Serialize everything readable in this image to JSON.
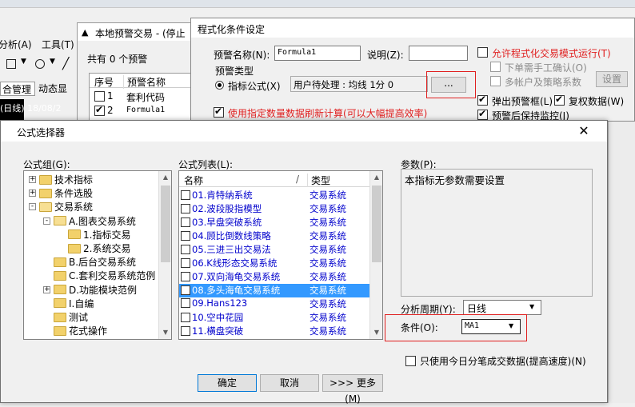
{
  "bg": {
    "menu_analysis": "分析(A)",
    "menu_tools": "工具(T)",
    "tab_manage": "合管理",
    "tab_dynamic": "动态显",
    "chart_label": "(日线) 18/08/2"
  },
  "local": {
    "title": "本地预警交易 - (停止",
    "count_text": "共有 0 个预警",
    "col_seq": "序号",
    "col_name": "预警名称",
    "rows": [
      {
        "seq": "1",
        "name": "套利代码",
        "checked": false
      },
      {
        "seq": "2",
        "name": "Formula1",
        "checked": true
      }
    ]
  },
  "condset": {
    "title": "程式化条件设定",
    "name_label": "预警名称(N):",
    "name_value": "Formula1",
    "desc_label": "说明(Z):",
    "desc_value": "",
    "allow_trade": "允许程式化交易模式运行(T)",
    "manual_confirm": "下单需手工确认(O)",
    "multi_account": "多帐户及策略系数",
    "setup_btn": "设置",
    "type_group": "预警类型",
    "type_formula": "指标公式(X)",
    "formula_display": "用户待处理 : 均线 1分  0",
    "browse_btn": "...",
    "popup_box": "弹出预警框(L)",
    "recheck": "复权数据(W)",
    "keep_monitor": "预警后保持监控(J)",
    "specified_refresh": "使用指定数量数据刷新计算(可以大幅提高效率)"
  },
  "selector": {
    "title": "公式选择器",
    "group_label": "公式组(G):",
    "list_label": "公式列表(L):",
    "col_name": "名称",
    "col_type": "类型",
    "sort_mark": "/",
    "tree": [
      {
        "level": 0,
        "expander": "+",
        "label": "技术指标"
      },
      {
        "level": 0,
        "expander": "+",
        "label": "条件选股"
      },
      {
        "level": 0,
        "expander": "-",
        "label": "交易系统"
      },
      {
        "level": 1,
        "expander": "-",
        "label": "A.图表交易系统"
      },
      {
        "level": 2,
        "expander": "",
        "label": "1.指标交易"
      },
      {
        "level": 2,
        "expander": "",
        "label": "2.系统交易"
      },
      {
        "level": 1,
        "expander": "",
        "label": "B.后台交易系统"
      },
      {
        "level": 1,
        "expander": "",
        "label": "C.套利交易系统范例"
      },
      {
        "level": 1,
        "expander": "+",
        "label": "D.功能模块范例"
      },
      {
        "level": 1,
        "expander": "",
        "label": "I.自编"
      },
      {
        "level": 1,
        "expander": "",
        "label": "测试"
      },
      {
        "level": 1,
        "expander": "",
        "label": "花式操作"
      }
    ],
    "formulas": [
      {
        "name": "01.肯特纳系统",
        "type": "交易系统"
      },
      {
        "name": "02.波段股指模型",
        "type": "交易系统"
      },
      {
        "name": "03.早盘突破系统",
        "type": "交易系统"
      },
      {
        "name": "04.顾比倒数线策略",
        "type": "交易系统"
      },
      {
        "name": "05.三进三出交易法",
        "type": "交易系统"
      },
      {
        "name": "06.K线形态交易系统",
        "type": "交易系统"
      },
      {
        "name": "07.双向海龟交易系统",
        "type": "交易系统"
      },
      {
        "name": "08.多头海龟交易系统",
        "type": "交易系统"
      },
      {
        "name": "09.Hans123",
        "type": "交易系统"
      },
      {
        "name": "10.空中花园",
        "type": "交易系统"
      },
      {
        "name": "11.横盘突破",
        "type": "交易系统"
      }
    ],
    "selected_index": 7,
    "params_label": "参数(P):",
    "params_text": "本指标无参数需要设置",
    "period_label": "分析周期(Y):",
    "period_value": "日线",
    "cond_label": "条件(O):",
    "cond_value": "MA1",
    "only_today": "只使用今日分笔成交数据(提高速度)(N)",
    "ok_btn": "确定",
    "cancel_btn": "取消",
    "more_btn": ">>> 更多(M)"
  },
  "colors": {
    "accent_red": "#e02020",
    "selection_blue": "#3399ff",
    "link_blue": "#0000cc"
  }
}
